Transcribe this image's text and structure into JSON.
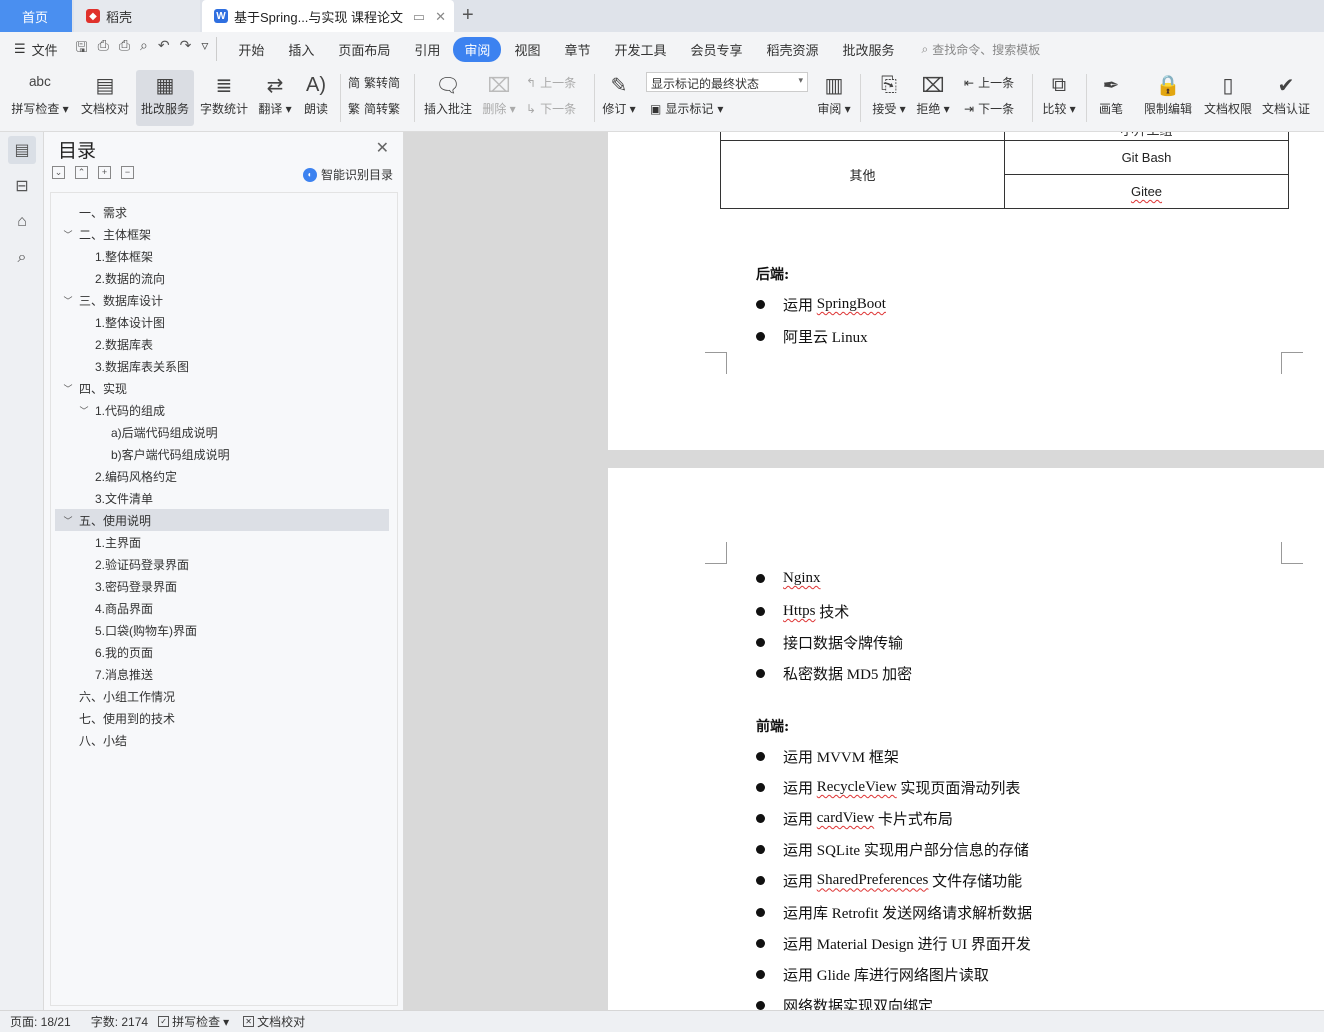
{
  "tabs": {
    "home": "首页",
    "daoke": "稻壳",
    "doc": "基于Spring...与实现 课程论文"
  },
  "menu": {
    "file": "文件",
    "tabs": [
      "开始",
      "插入",
      "页面布局",
      "引用",
      "审阅",
      "视图",
      "章节",
      "开发工具",
      "会员专享",
      "稻壳资源",
      "批改服务"
    ],
    "active_tab": "审阅",
    "search_placeholder": "查找命令、搜索模板"
  },
  "ribbon": {
    "spell": "拼写检查",
    "doc_proof": "文档校对",
    "correct_service": "批改服务",
    "word_count": "字数统计",
    "translate": "翻译",
    "read_aloud": "朗读",
    "trad_to_simp": "繁转简",
    "simp_to_trad": "简转繁",
    "insert_comment": "插入批注",
    "delete": "删除",
    "prev": "上一条",
    "next": "下一条",
    "revise": "修订",
    "markup_state": "显示标记的最终状态",
    "show_markup": "显示标记",
    "review": "审阅",
    "accept": "接受",
    "reject": "拒绝",
    "prev2": "上一条",
    "next2": "下一条",
    "compare": "比较",
    "pen": "画笔",
    "restrict": "限制编辑",
    "permission": "文档权限",
    "certify": "文档认证"
  },
  "toc": {
    "title": "目录",
    "smart": "智能识别目录",
    "items": [
      {
        "label": "一、需求",
        "level": 0,
        "chev": ""
      },
      {
        "label": "二、主体框架",
        "level": 0,
        "chev": "v"
      },
      {
        "label": "1.整体框架",
        "level": 1,
        "chev": ""
      },
      {
        "label": "2.数据的流向",
        "level": 1,
        "chev": ""
      },
      {
        "label": "三、数据库设计",
        "level": 0,
        "chev": "v"
      },
      {
        "label": "1.整体设计图",
        "level": 1,
        "chev": ""
      },
      {
        "label": "2.数据库表",
        "level": 1,
        "chev": ""
      },
      {
        "label": "3.数据库表关系图",
        "level": 1,
        "chev": ""
      },
      {
        "label": "四、实现",
        "level": 0,
        "chev": "v"
      },
      {
        "label": "1.代码的组成",
        "level": 1,
        "chev": "v"
      },
      {
        "label": "a)后端代码组成说明",
        "level": 2,
        "chev": ""
      },
      {
        "label": "b)客户端代码组成说明",
        "level": 2,
        "chev": ""
      },
      {
        "label": "2.编码风格约定",
        "level": 1,
        "chev": ""
      },
      {
        "label": "3.文件清单",
        "level": 1,
        "chev": ""
      },
      {
        "label": "五、使用说明",
        "level": 0,
        "chev": "v",
        "selected": true
      },
      {
        "label": "1.主界面",
        "level": 1,
        "chev": ""
      },
      {
        "label": "2.验证码登录界面",
        "level": 1,
        "chev": ""
      },
      {
        "label": "3.密码登录界面",
        "level": 1,
        "chev": ""
      },
      {
        "label": "4.商品界面",
        "level": 1,
        "chev": ""
      },
      {
        "label": "5.口袋(购物车)界面",
        "level": 1,
        "chev": ""
      },
      {
        "label": "6.我的页面",
        "level": 1,
        "chev": ""
      },
      {
        "label": "7.消息推送",
        "level": 1,
        "chev": ""
      },
      {
        "label": "六、小组工作情况",
        "level": 0,
        "chev": ""
      },
      {
        "label": "七、使用到的技术",
        "level": 0,
        "chev": ""
      },
      {
        "label": "八、小结",
        "level": 0,
        "chev": ""
      }
    ]
  },
  "doc": {
    "table_cut": "小开工组",
    "table_other": "其他",
    "table_git": "Git Bash",
    "table_gitee": "Gitee",
    "backend_heading": "后端:",
    "backend_items": [
      {
        "pre": "运用 ",
        "sq": "SpringBoot",
        "post": ""
      },
      {
        "pre": "阿里云 Linux",
        "sq": "",
        "post": ""
      }
    ],
    "page2_items": [
      {
        "pre": "",
        "sq": "Nginx",
        "post": ""
      },
      {
        "pre": "",
        "sq": "Https",
        "post": " 技术"
      },
      {
        "pre": "接口数据令牌传输",
        "sq": "",
        "post": ""
      },
      {
        "pre": "私密数据 MD5 加密",
        "sq": "",
        "post": ""
      }
    ],
    "frontend_heading": "前端:",
    "frontend_items": [
      {
        "pre": "运用 MVVM 框架",
        "sq": "",
        "post": ""
      },
      {
        "pre": "运用 ",
        "sq": "RecycleView",
        "post": " 实现页面滑动列表"
      },
      {
        "pre": "运用 ",
        "sq": "cardView",
        "post": " 卡片式布局"
      },
      {
        "pre": "运用 SQLite 实现用户部分信息的存储",
        "sq": "",
        "post": ""
      },
      {
        "pre": "运用 ",
        "sq": "SharedPreferences",
        "post": " 文件存储功能"
      },
      {
        "pre": "运用库 Retrofit 发送网络请求解析数据",
        "sq": "",
        "post": ""
      },
      {
        "pre": "运用 Material Design 进行 UI 界面开发",
        "sq": "",
        "post": ""
      },
      {
        "pre": "运用 Glide 库进行网络图片读取",
        "sq": "",
        "post": ""
      },
      {
        "pre": "网络数据实现双向绑定",
        "sq": "",
        "post": ""
      }
    ]
  },
  "status": {
    "page": "页面: 18/21",
    "words": "字数: 2174",
    "spell": "拼写检查",
    "proof": "文档校对"
  }
}
